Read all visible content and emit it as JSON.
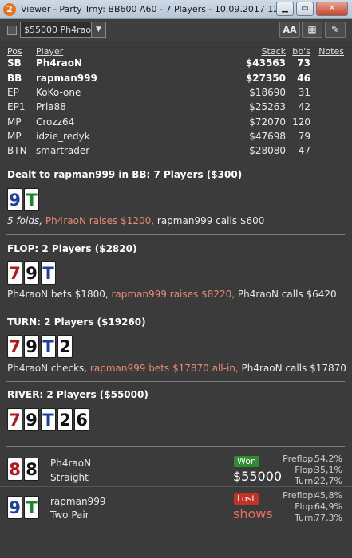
{
  "window": {
    "title": "Viewer - Party Trny: BB600 A60 - 7 Players - 10.09.2017 12:54",
    "app_icon": "2"
  },
  "toolbar": {
    "pot_filter": "$55000 Ph4raoN",
    "font_button": "AA"
  },
  "table_headers": {
    "pos": "Pos",
    "player": "Player",
    "stack": "Stack",
    "bbs": "bb's",
    "notes": "Notes"
  },
  "players": [
    {
      "pos": "SB",
      "name": "Ph4raoN",
      "stack": "$43563",
      "bbs": "73"
    },
    {
      "pos": "BB",
      "name": "rapman999",
      "stack": "$27350",
      "bbs": "46"
    },
    {
      "pos": "EP",
      "name": "KoKo-one",
      "stack": "$18690",
      "bbs": "31"
    },
    {
      "pos": "EP1",
      "name": "Prla88",
      "stack": "$25263",
      "bbs": "42"
    },
    {
      "pos": "MP",
      "name": "Crozz64",
      "stack": "$72070",
      "bbs": "120"
    },
    {
      "pos": "MP",
      "name": "idzie_redyk",
      "stack": "$47698",
      "bbs": "79"
    },
    {
      "pos": "BTN",
      "name": "smartrader",
      "stack": "$28080",
      "bbs": "47"
    }
  ],
  "preflop": {
    "title": "Dealt to rapman999 in BB: 7 Players ($300)",
    "cards": [
      "9",
      "T"
    ],
    "a1": "5 folds, ",
    "a2": "Ph4raoN raises $1200, ",
    "a3": "rapman999 calls $600"
  },
  "flop": {
    "title": "FLOP: 2 Players ($2820)",
    "cards": [
      "7",
      "9",
      "T"
    ],
    "a1": "Ph4raoN bets $1800, ",
    "a2": "rapman999 raises $8220, ",
    "a3": "Ph4raoN calls $6420"
  },
  "turn": {
    "title": "TURN: 2 Players ($19260)",
    "cards": [
      "7",
      "9",
      "T",
      "2"
    ],
    "a1": "Ph4raoN checks, ",
    "a2": "rapman999 bets $17870 all-in, ",
    "a3": "Ph4raoN calls $17870"
  },
  "river": {
    "title": "RIVER: 2 Players ($55000)",
    "cards": [
      "7",
      "9",
      "T",
      "2",
      "6"
    ]
  },
  "results": [
    {
      "name": "Ph4raoN",
      "hand": "Straight",
      "cards": [
        "8",
        "8"
      ],
      "badge": "Won",
      "amount": "$55000",
      "preflop_label": "Preflop:",
      "preflop": "54,2%",
      "flop_label": "Flop:",
      "flop": "35,1%",
      "turn_label": "Turn:",
      "turn": "22,7%"
    },
    {
      "name": "rapman999",
      "hand": "Two Pair",
      "cards": [
        "9",
        "T"
      ],
      "badge": "Lost",
      "amount": "shows",
      "preflop_label": "Preflop:",
      "preflop": "45,8%",
      "flop_label": "Flop:",
      "flop": "64,9%",
      "turn_label": "Turn:",
      "turn": "77,3%"
    }
  ],
  "colors": {
    "won": "#2f8c2f",
    "lost": "#c43226",
    "highlight": "#e98a75",
    "background": "#3b3b3b"
  }
}
